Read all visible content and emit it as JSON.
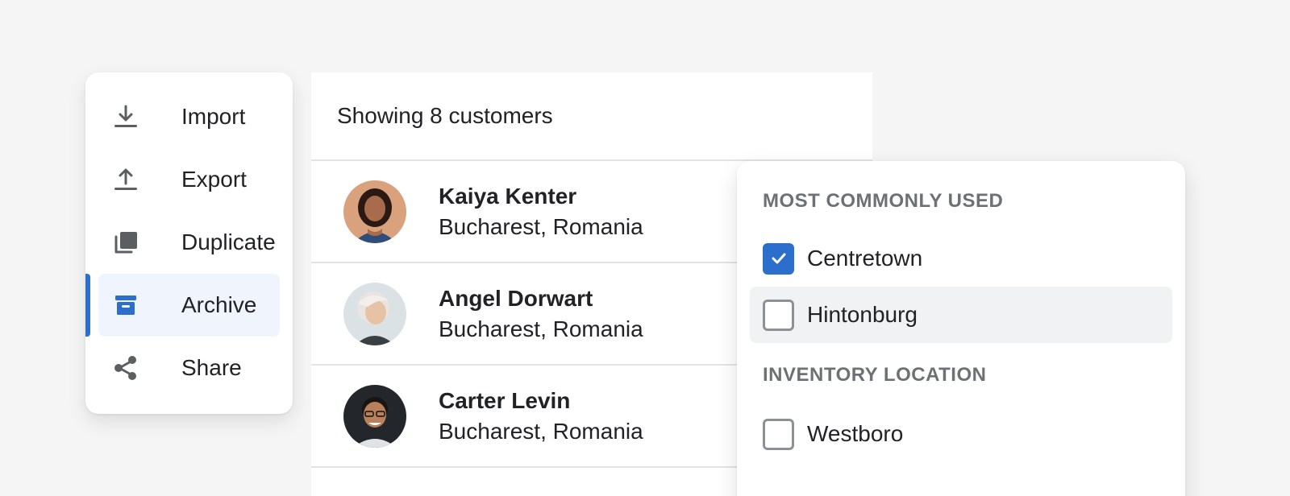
{
  "action_menu": {
    "items": [
      {
        "label": "Import",
        "icon": "import-icon",
        "active": false
      },
      {
        "label": "Export",
        "icon": "export-icon",
        "active": false
      },
      {
        "label": "Duplicate",
        "icon": "duplicate-icon",
        "active": false
      },
      {
        "label": "Archive",
        "icon": "archive-icon",
        "active": true
      },
      {
        "label": "Share",
        "icon": "share-icon",
        "active": false
      }
    ]
  },
  "customer_list": {
    "header": "Showing 8 customers",
    "rows": [
      {
        "name": "Kaiya Kenter",
        "location": "Bucharest, Romania"
      },
      {
        "name": "Angel Dorwart",
        "location": "Bucharest, Romania"
      },
      {
        "name": "Carter Levin",
        "location": "Bucharest, Romania"
      }
    ]
  },
  "filter_popover": {
    "sections": [
      {
        "title": "MOST COMMONLY USED",
        "options": [
          {
            "label": "Centretown",
            "checked": true
          },
          {
            "label": "Hintonburg",
            "checked": false
          }
        ]
      },
      {
        "title": "INVENTORY LOCATION",
        "options": [
          {
            "label": "Westboro",
            "checked": false
          }
        ]
      }
    ]
  },
  "colors": {
    "accent": "#2c6ecb",
    "active_bg": "#f0f5fd",
    "icon_gray": "#5c5f62",
    "section_title": "#6d7175",
    "divider": "#e1e3e5"
  }
}
